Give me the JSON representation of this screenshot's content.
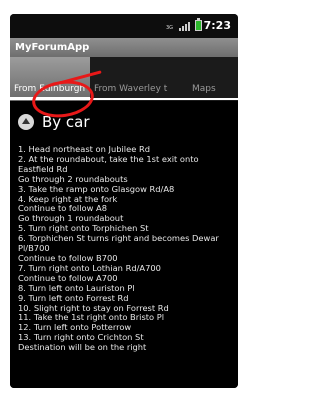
{
  "status_bar": {
    "network_badge": "3G",
    "time": "7:23",
    "icons": [
      "signal-icon",
      "battery-icon"
    ],
    "battery_color": "#2db82d"
  },
  "app": {
    "title": "MyForumApp"
  },
  "tabs": [
    {
      "label": "From Edinburgh",
      "selected": true
    },
    {
      "label": "From Waverley t",
      "selected": false
    },
    {
      "label": "Maps",
      "selected": false
    }
  ],
  "section": {
    "label": "By car",
    "icon": "collapse-up-icon"
  },
  "steps": [
    "1. Head northeast on Jubilee Rd",
    "2. At the roundabout, take the 1st exit onto Eastfield Rd",
    "Go through 2 roundabouts",
    "3. Take the ramp onto Glasgow Rd/A8",
    "4. Keep right at the fork",
    "Continue to follow A8",
    "Go through 1 roundabout",
    "5. Turn right onto Torphichen St",
    "6. Torphichen St turns right and becomes Dewar Pl/B700",
    "Continue to follow B700",
    "7. Turn right onto Lothian Rd/A700",
    "Continue to follow A700",
    "8. Turn left onto Lauriston Pl",
    "9. Turn left onto Forrest Rd",
    "10. Slight right to stay on Forrest Rd",
    "11. Take the 1st right onto Bristo Pl",
    "12. Turn left onto Potterrow",
    "13. Turn right onto Crichton St",
    "Destination will be on the right"
  ],
  "annotation": {
    "color": "#e81818"
  }
}
